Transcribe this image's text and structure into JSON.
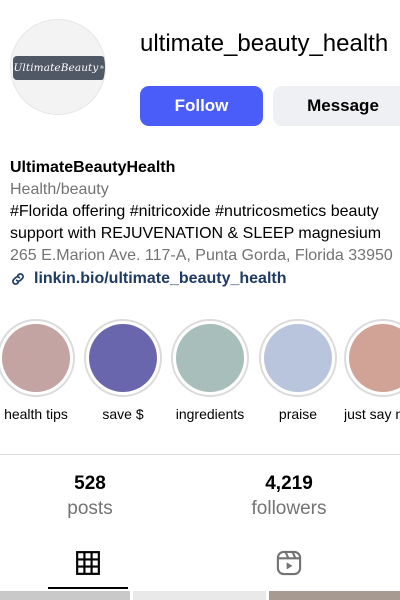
{
  "profile": {
    "username": "ultimate_beauty_health",
    "avatar_text": "UltimateBeauty",
    "avatar_mark": "®",
    "follow_label": "Follow",
    "message_label": "Message"
  },
  "bio": {
    "name": "UltimateBeautyHealth",
    "category": "Health/beauty",
    "line1": "#Florida offering #nitricoxide #nutricosmetics beauty",
    "line2": "support with REJUVENATION & SLEEP magnesium",
    "address": "265 E.Marion Ave. 117-A, Punta Gorda, Florida 33950",
    "link": "linkin.bio/ultimate_beauty_health"
  },
  "highlights": [
    {
      "label": "health tips",
      "color": "#c4a3a3"
    },
    {
      "label": "save $",
      "color": "#6a66ad"
    },
    {
      "label": "ingredients",
      "color": "#a8bebb"
    },
    {
      "label": "praise",
      "color": "#b9c4dd"
    },
    {
      "label": "just say n",
      "color": "#d1a397"
    }
  ],
  "stats": {
    "posts_count": "528",
    "posts_label": "posts",
    "followers_count": "4,219",
    "followers_label": "followers"
  },
  "tabs": [
    {
      "name": "grid-icon",
      "active": true
    },
    {
      "name": "reels-icon",
      "active": false
    }
  ],
  "colors": {
    "accent": "#4a5df9",
    "secondary_text": "#737373",
    "link": "#1f3a63"
  }
}
